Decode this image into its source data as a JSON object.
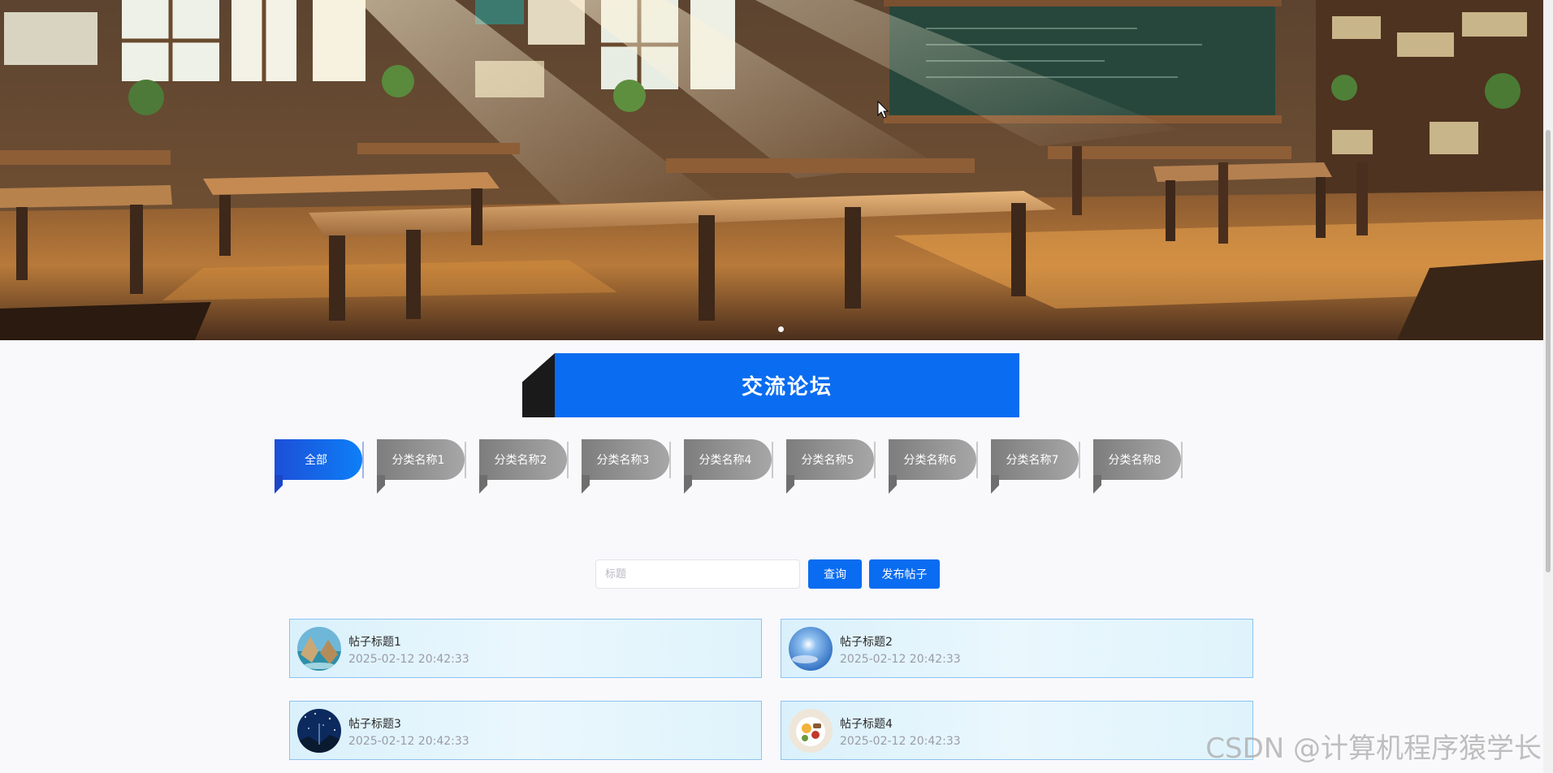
{
  "banner": {
    "slide_count": 1,
    "active_slide": 0
  },
  "forum": {
    "title": "交流论坛"
  },
  "categories": {
    "active_index": 0,
    "items": [
      {
        "label": "全部"
      },
      {
        "label": "分类名称1"
      },
      {
        "label": "分类名称2"
      },
      {
        "label": "分类名称3"
      },
      {
        "label": "分类名称4"
      },
      {
        "label": "分类名称5"
      },
      {
        "label": "分类名称6"
      },
      {
        "label": "分类名称7"
      },
      {
        "label": "分类名称8"
      }
    ]
  },
  "search": {
    "placeholder": "标题",
    "value": "",
    "search_label": "查询",
    "publish_label": "发布帖子"
  },
  "posts": [
    {
      "title": "帖子标题1",
      "time": "2025-02-12 20:42:33",
      "avatar": "seaside-cliff-photo"
    },
    {
      "title": "帖子标题2",
      "time": "2025-02-12 20:42:33",
      "avatar": "blue-sky-sun-photo"
    },
    {
      "title": "帖子标题3",
      "time": "2025-02-12 20:42:33",
      "avatar": "night-sky-photo"
    },
    {
      "title": "帖子标题4",
      "time": "2025-02-12 20:42:33",
      "avatar": "food-plate-photo"
    }
  ],
  "watermark": {
    "text": "CSDN @计算机程序猿学长"
  },
  "colors": {
    "primary": "#0a6cf0",
    "card_border": "#8cc3ef",
    "card_bg": "#eaf7fd",
    "tab_inactive": "#9a9a9a",
    "page_bg": "#f9f9fc"
  }
}
